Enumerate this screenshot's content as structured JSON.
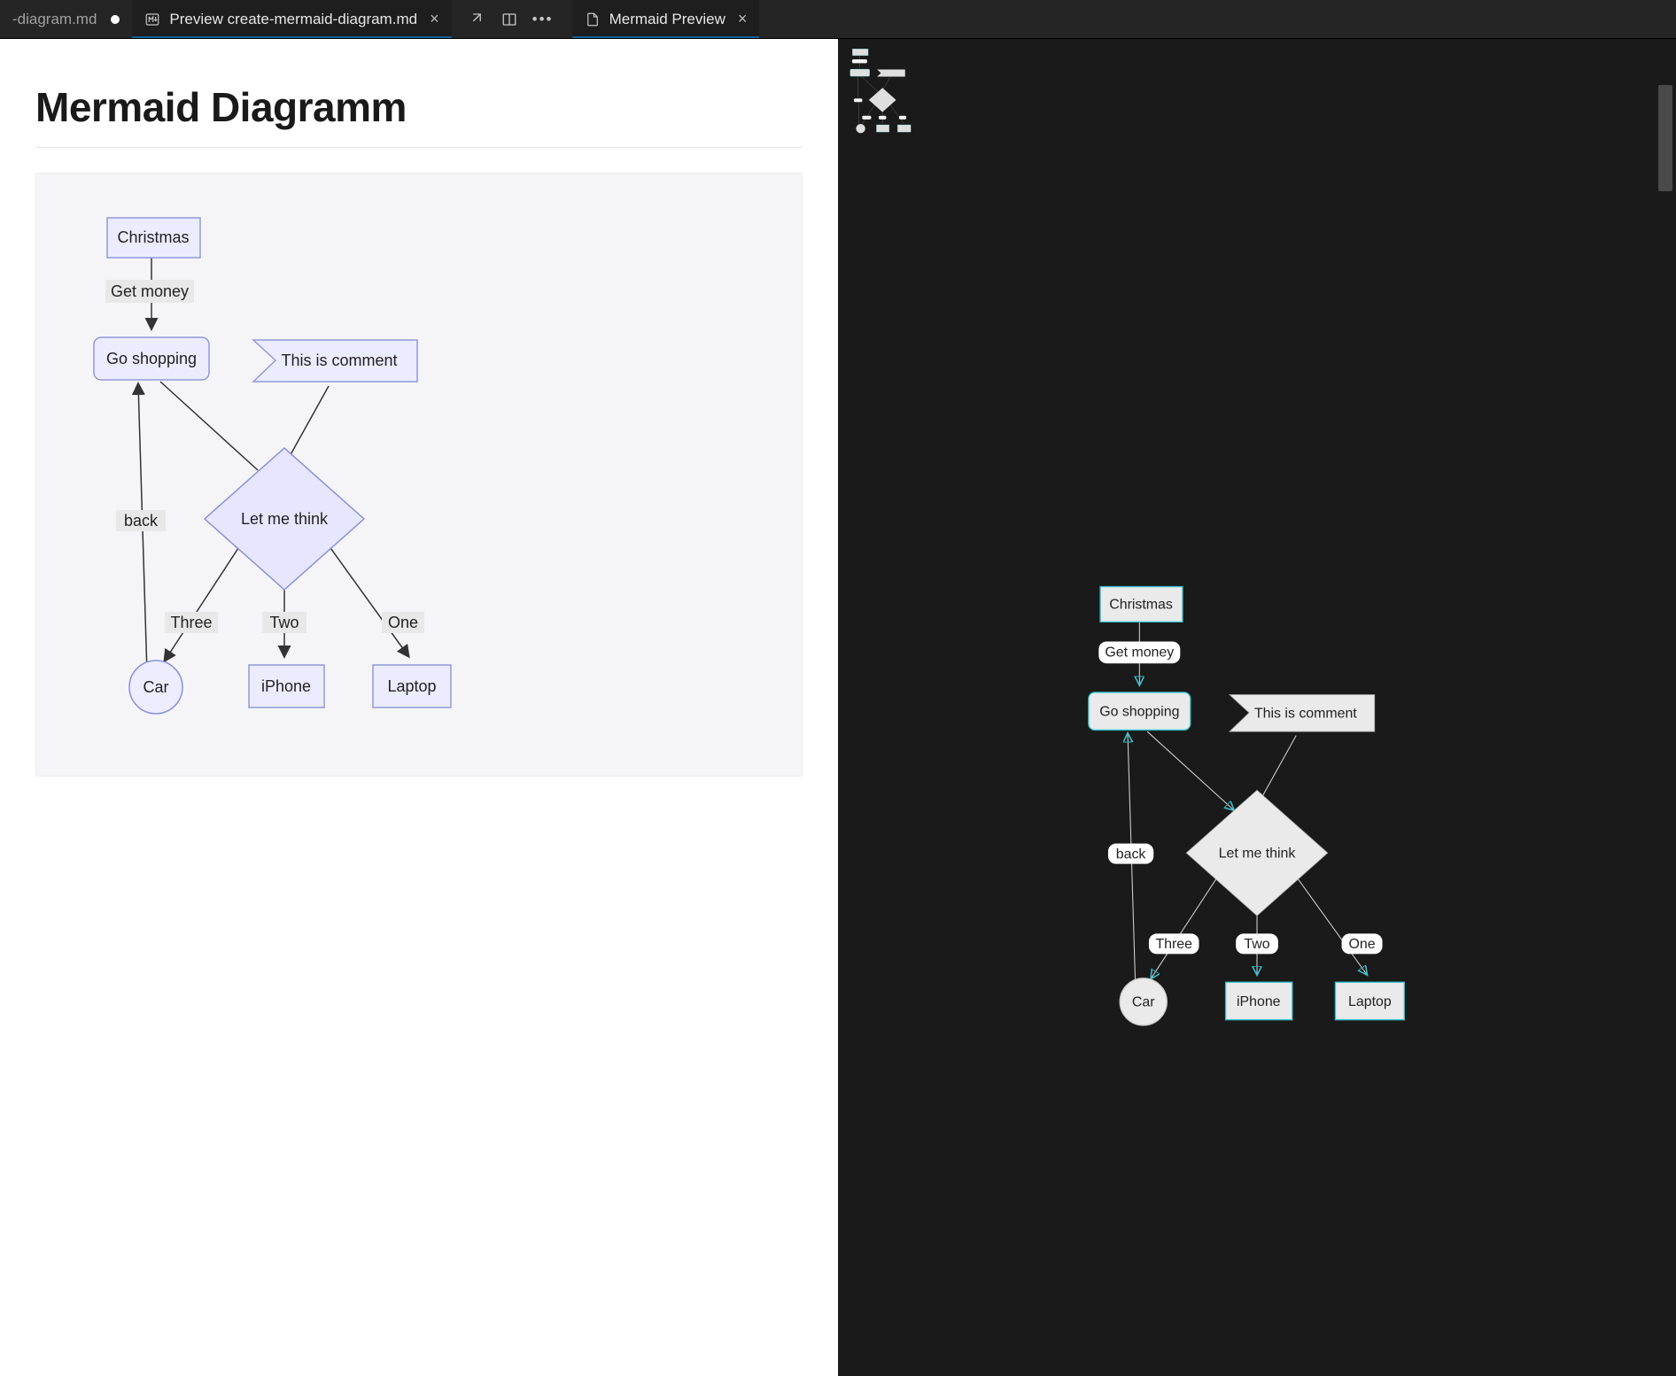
{
  "tabs": {
    "editor": {
      "label": "-diagram.md"
    },
    "preview": {
      "label": "Preview create-mermaid-diagram.md"
    },
    "mermaid": {
      "label": "Mermaid Preview"
    }
  },
  "document": {
    "heading": "Mermaid Diagramm"
  },
  "diagram": {
    "nodes": {
      "christmas": "Christmas",
      "get_money": "Get money",
      "go_shopping": "Go shopping",
      "comment": "This is comment",
      "let_me_think": "Let me think",
      "back": "back",
      "three": "Three",
      "two": "Two",
      "one": "One",
      "car": "Car",
      "iphone": "iPhone",
      "laptop": "Laptop"
    }
  },
  "chart_data": {
    "type": "flowchart",
    "direction": "TD",
    "nodes": [
      {
        "id": "christmas",
        "label": "Christmas",
        "shape": "rect"
      },
      {
        "id": "go_shopping",
        "label": "Go shopping",
        "shape": "round-rect"
      },
      {
        "id": "comment",
        "label": "This is comment",
        "shape": "flag"
      },
      {
        "id": "let_me_think",
        "label": "Let me think",
        "shape": "diamond"
      },
      {
        "id": "car",
        "label": "Car",
        "shape": "circle"
      },
      {
        "id": "iphone",
        "label": "iPhone",
        "shape": "rect"
      },
      {
        "id": "laptop",
        "label": "Laptop",
        "shape": "rect"
      }
    ],
    "edges": [
      {
        "from": "christmas",
        "to": "go_shopping",
        "label": "Get money"
      },
      {
        "from": "go_shopping",
        "to": "let_me_think",
        "label": ""
      },
      {
        "from": "comment",
        "to": "let_me_think",
        "label": ""
      },
      {
        "from": "let_me_think",
        "to": "laptop",
        "label": "One"
      },
      {
        "from": "let_me_think",
        "to": "iphone",
        "label": "Two"
      },
      {
        "from": "let_me_think",
        "to": "car",
        "label": "Three"
      },
      {
        "from": "car",
        "to": "go_shopping",
        "label": "back"
      }
    ]
  }
}
